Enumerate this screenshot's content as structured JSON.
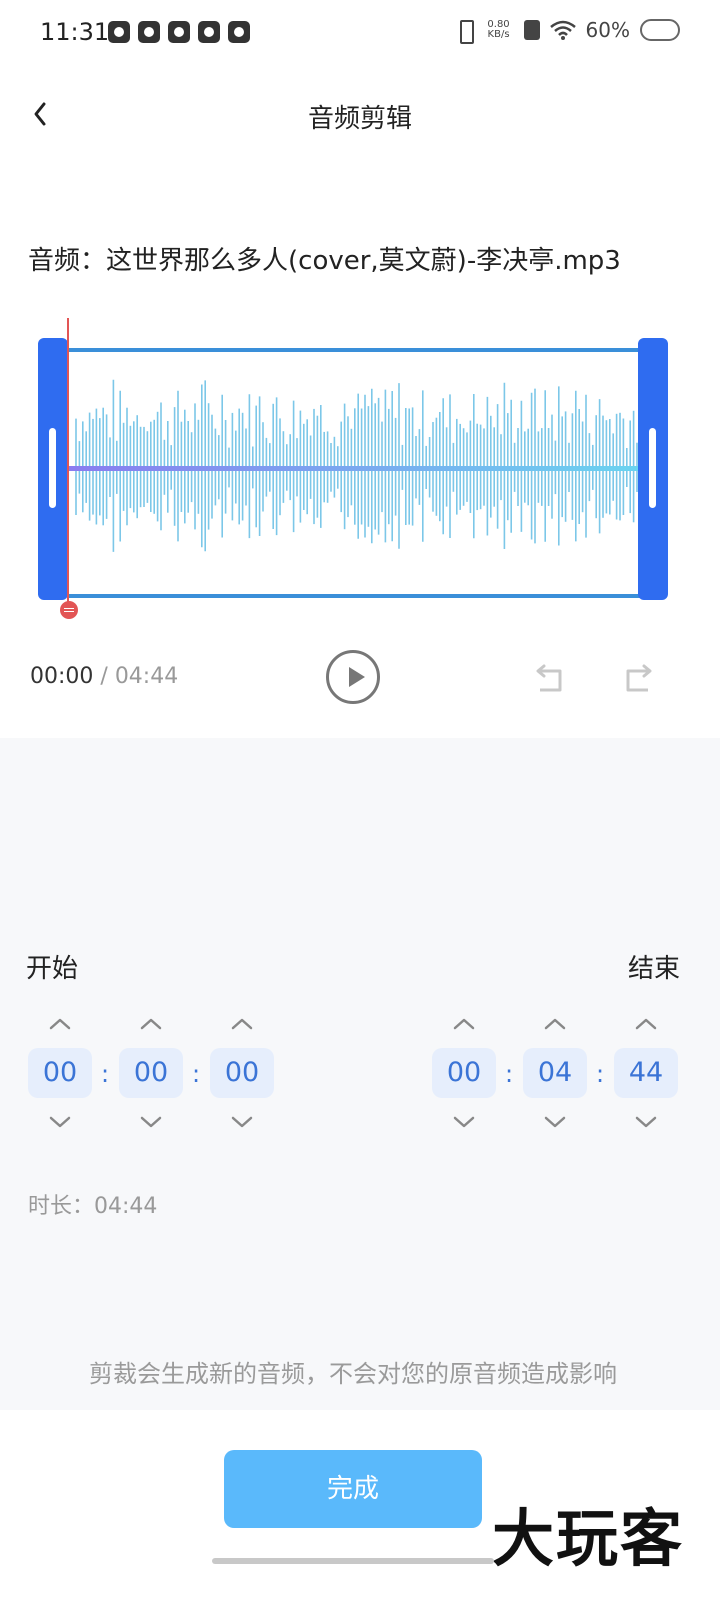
{
  "status_bar": {
    "time": "11:31",
    "net_speed_value": "0.80",
    "net_speed_unit": "KB/s",
    "battery": "60%"
  },
  "header": {
    "title": "音频剪辑"
  },
  "file": {
    "label": "音频：这世界那么多人(cover,莫文蔚)-李决亭.mp3"
  },
  "player": {
    "current_time": "00:00",
    "separator": " / ",
    "total_time": "04:44"
  },
  "trim": {
    "start_label": "开始",
    "end_label": "结束",
    "start": [
      "00",
      "00",
      "00"
    ],
    "end": [
      "00",
      "04",
      "44"
    ],
    "colon": ":",
    "duration_label": "时长：04:44"
  },
  "notice": "剪裁会生成新的音频，不会对您的原音频造成影响",
  "done_label": "完成",
  "watermark": "大玩客",
  "colors": {
    "accent": "#2f6cf0",
    "wave": "#7cc7e8",
    "playhead": "#e25555",
    "done_button": "#5ab9fb",
    "time_box": "#e6eefc",
    "time_text": "#3b74d6"
  }
}
